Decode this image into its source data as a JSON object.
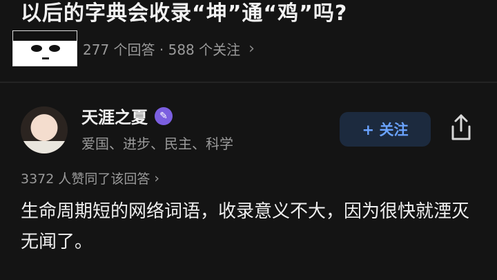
{
  "question": {
    "title": "以后的字典会收录“坤”通“鸡”吗?",
    "stats": "277 个回答 · 588 个关注",
    "chevron": "›"
  },
  "answer": {
    "author": {
      "name": "天涯之夏",
      "tags": "爱国、进步、民主、科学",
      "badge_icon": "verified-badge-icon"
    },
    "follow_label": "+ 关注",
    "votes_text": "3372 人赞同了该回答",
    "votes_chevron": "›",
    "body": "生命周期短的网络词语，收录意义不大，因为很快就湮灭无闻了。"
  },
  "colors": {
    "background": "#141414",
    "accent": "#6aa3ff",
    "badge": "#7b5fe0"
  }
}
